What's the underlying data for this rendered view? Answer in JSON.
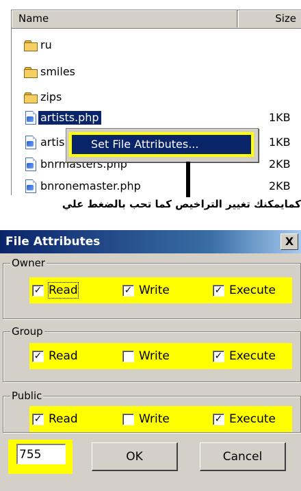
{
  "file_list": {
    "columns": {
      "name": "Name",
      "size": "Size"
    },
    "rows": [
      {
        "name": "ru",
        "size": "",
        "type": "folder"
      },
      {
        "name": "smiles",
        "size": "",
        "type": "folder"
      },
      {
        "name": "zips",
        "size": "",
        "type": "folder"
      },
      {
        "name": "artists.php",
        "size": "1KB",
        "type": "php"
      },
      {
        "name": "artis",
        "size": "1KB",
        "type": "php"
      },
      {
        "name": "bnrmasters.php",
        "size": "2KB",
        "type": "php"
      },
      {
        "name": "bnronemaster.php",
        "size": "2KB",
        "type": "php"
      }
    ]
  },
  "context_menu": {
    "item": "Set File Attributes..."
  },
  "caption": "كمايمكنك تغيير التراخيص كما تحب بالضغط علي",
  "dialog": {
    "title": "File Attributes",
    "close": "X",
    "groups": [
      {
        "name": "Owner",
        "read": "Read",
        "write": "Write",
        "execute": "Execute",
        "read_checked": true,
        "write_checked": true,
        "execute_checked": true
      },
      {
        "name": "Group",
        "read": "Read",
        "write": "Write",
        "execute": "Execute",
        "read_checked": true,
        "write_checked": false,
        "execute_checked": true
      },
      {
        "name": "Public",
        "read": "Read",
        "write": "Write",
        "execute": "Execute",
        "read_checked": true,
        "write_checked": false,
        "execute_checked": true
      }
    ],
    "octal_value": "755",
    "ok_label": "OK",
    "cancel_label": "Cancel"
  },
  "colors": {
    "highlight": "#ffff00",
    "selection": "#0a246a",
    "dialog_bg": "#d4d0c8"
  },
  "icons": {
    "folder": "folder-icon",
    "php": "php-file-icon"
  }
}
